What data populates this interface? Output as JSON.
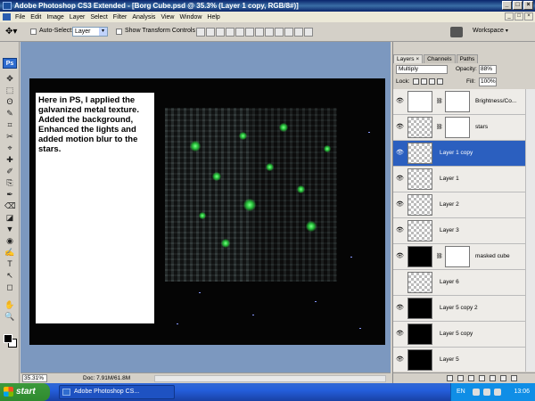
{
  "window": {
    "title": "Adobe Photoshop CS3 Extended - [Borg Cube.psd @ 35.3% (Layer 1 copy, RGB/8#)]",
    "controls": [
      "_",
      "□",
      "×"
    ]
  },
  "menu": {
    "items": [
      "File",
      "Edit",
      "Image",
      "Layer",
      "Select",
      "Filter",
      "Analysis",
      "View",
      "Window",
      "Help"
    ],
    "doc_controls": [
      "_",
      "□",
      "×"
    ]
  },
  "options": {
    "auto_select_label": "Auto-Select:",
    "auto_select_value": "Layer",
    "show_transform_label": "Show Transform Controls",
    "workspace_label": "Workspace",
    "workspace_arrow": "▾"
  },
  "tools": {
    "logo": "Ps",
    "glyphs": [
      "✥",
      "⬚",
      "ʘ",
      "✎",
      "⌗",
      "✂",
      "⌖",
      "✚",
      "✐",
      "⎘",
      "✒",
      "⌫",
      "◪",
      "▼",
      "◉",
      "✍",
      "T",
      "↖",
      "◻",
      "✋",
      "🔍"
    ]
  },
  "canvas": {
    "note_text": "Here in PS, I applied the galvanized metal texture. Added the background, Enhanced the lights and added motion blur to the stars."
  },
  "status": {
    "zoom": "35.31%",
    "doc_size": "Doc: 7.91M/61.8M"
  },
  "layers_panel": {
    "tabs": [
      "Layers ×",
      "Channels",
      "Paths"
    ],
    "blend_mode": "Multiply",
    "opacity_label": "Opacity:",
    "opacity_value": "88%",
    "lock_label": "Lock:",
    "fill_label": "Fill:",
    "fill_value": "100%",
    "layers": [
      {
        "name": "Brightness/Co...",
        "visible": true,
        "selected": false
      },
      {
        "name": "stars",
        "visible": true,
        "selected": false
      },
      {
        "name": "Layer 1 copy",
        "visible": true,
        "selected": true
      },
      {
        "name": "Layer 1",
        "visible": true,
        "selected": false
      },
      {
        "name": "Layer 2",
        "visible": true,
        "selected": false
      },
      {
        "name": "Layer 3",
        "visible": true,
        "selected": false
      },
      {
        "name": "masked cube",
        "visible": true,
        "selected": false
      },
      {
        "name": "Layer 6",
        "visible": false,
        "selected": false
      },
      {
        "name": "Layer 5 copy 2",
        "visible": true,
        "selected": false
      },
      {
        "name": "Layer 5 copy",
        "visible": true,
        "selected": false
      },
      {
        "name": "Layer 5",
        "visible": true,
        "selected": false
      }
    ]
  },
  "taskbar": {
    "start_label": "start",
    "task_label": "Adobe Photoshop CS...",
    "language": "EN",
    "clock": "13:06"
  }
}
